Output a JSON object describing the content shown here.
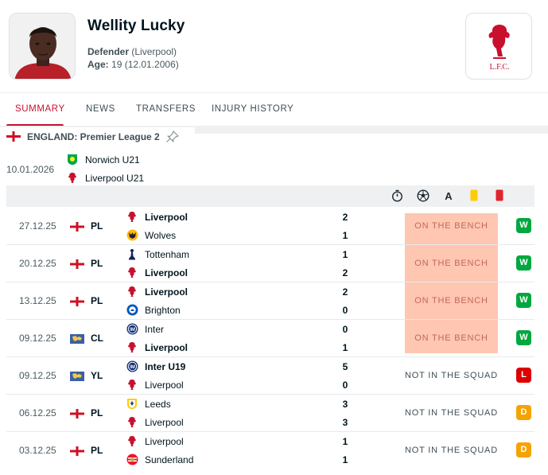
{
  "player": {
    "name": "Wellity Lucky",
    "position": "Defender",
    "team_paren": "(Liverpool)",
    "age_label": "Age:",
    "age_value": "19 (12.01.2006)"
  },
  "club_logo_text": "L.F.C.",
  "tabs": [
    "SUMMARY",
    "NEWS",
    "TRANSFERS",
    "INJURY HISTORY"
  ],
  "league": {
    "country": "ENGLAND",
    "name": "Premier League 2",
    "full": "ENGLAND: Premier League 2"
  },
  "upcoming": {
    "date": "10.01.2026",
    "home": "Norwich U21",
    "away": "Liverpool U21"
  },
  "column_icons": [
    "stopwatch-icon",
    "ball-icon",
    "assist-icon",
    "yellow-card-icon",
    "red-card-icon"
  ],
  "matches": [
    {
      "date": "27.12.25",
      "flag": "england",
      "comp": "PL",
      "home": "Liverpool",
      "home_logo": "liverpool",
      "home_bold": true,
      "away": "Wolves",
      "away_logo": "wolves",
      "away_bold": false,
      "home_score": "2",
      "away_score": "1",
      "status": "ON THE BENCH",
      "status_type": "bench",
      "result": "W"
    },
    {
      "date": "20.12.25",
      "flag": "england",
      "comp": "PL",
      "home": "Tottenham",
      "home_logo": "tottenham",
      "home_bold": false,
      "away": "Liverpool",
      "away_logo": "liverpool",
      "away_bold": true,
      "home_score": "1",
      "away_score": "2",
      "status": "ON THE BENCH",
      "status_type": "bench",
      "result": "W"
    },
    {
      "date": "13.12.25",
      "flag": "england",
      "comp": "PL",
      "home": "Liverpool",
      "home_logo": "liverpool",
      "home_bold": true,
      "away": "Brighton",
      "away_logo": "brighton",
      "away_bold": false,
      "home_score": "2",
      "away_score": "0",
      "status": "ON THE BENCH",
      "status_type": "bench",
      "result": "W"
    },
    {
      "date": "09.12.25",
      "flag": "europe",
      "comp": "CL",
      "home": "Inter",
      "home_logo": "inter",
      "home_bold": false,
      "away": "Liverpool",
      "away_logo": "liverpool",
      "away_bold": true,
      "home_score": "0",
      "away_score": "1",
      "status": "ON THE BENCH",
      "status_type": "bench",
      "result": "W"
    },
    {
      "date": "09.12.25",
      "flag": "europe",
      "comp": "YL",
      "home": "Inter U19",
      "home_logo": "inter",
      "home_bold": true,
      "away": "Liverpool",
      "away_logo": "liverpool",
      "away_bold": false,
      "home_score": "5",
      "away_score": "0",
      "status": "NOT IN THE SQUAD",
      "status_type": "squad",
      "result": "L"
    },
    {
      "date": "06.12.25",
      "flag": "england",
      "comp": "PL",
      "home": "Leeds",
      "home_logo": "leeds",
      "home_bold": false,
      "away": "Liverpool",
      "away_logo": "liverpool",
      "away_bold": false,
      "home_score": "3",
      "away_score": "3",
      "status": "NOT IN THE SQUAD",
      "status_type": "squad",
      "result": "D"
    },
    {
      "date": "03.12.25",
      "flag": "england",
      "comp": "PL",
      "home": "Liverpool",
      "home_logo": "liverpool",
      "home_bold": false,
      "away": "Sunderland",
      "away_logo": "sunderland",
      "away_bold": false,
      "home_score": "1",
      "away_score": "1",
      "status": "NOT IN THE SQUAD",
      "status_type": "squad",
      "result": "D"
    }
  ],
  "colors": {
    "accent": "#c8102e",
    "win": "#00a83f",
    "loss": "#dc0000",
    "draw": "#f5a300",
    "bench_bg": "#ffc6b2",
    "yellow_card": "#ffcd00",
    "red_card": "#e0242b"
  }
}
